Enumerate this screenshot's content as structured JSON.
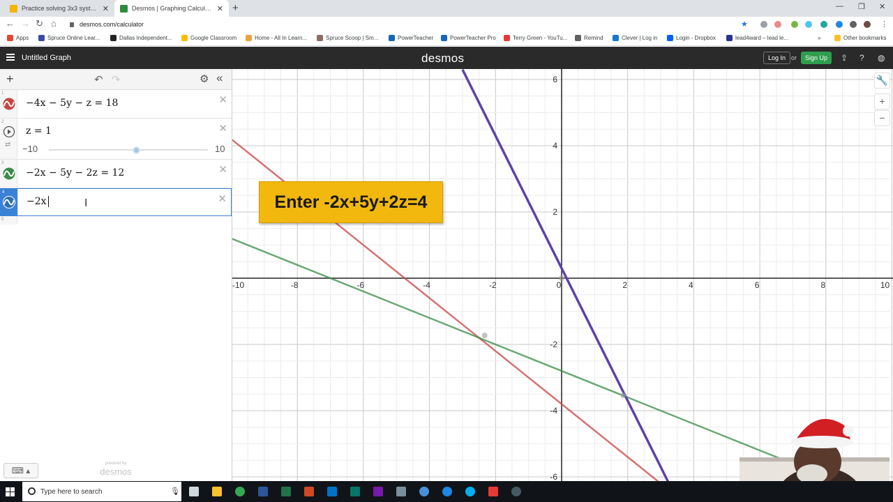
{
  "browser": {
    "tabs": [
      {
        "title": "Practice solving 3x3 systems De",
        "active": false,
        "color": "#f4b400"
      },
      {
        "title": "Desmos | Graphing Calculator",
        "active": true,
        "color": "#2e8b3e"
      }
    ],
    "url": "desmos.com/calculator",
    "bookmarks": [
      "Apps",
      "Spruce Online Lear...",
      "Dallas Independent...",
      "Google Classroom",
      "Home - All In Learn...",
      "Spruce Scoop | Sm...",
      "PowerTeacher",
      "PowerTeacher Pro",
      "Terry Green - YouTu...",
      "Remind",
      "Clever | Log in",
      "Login - Dropbox",
      "lead4ward – lead le..."
    ],
    "other_bookmarks": "Other bookmarks"
  },
  "desmos": {
    "graph_title": "Untitled Graph",
    "logo": "desmos",
    "login": "Log In",
    "or": "or",
    "signup": "Sign Up",
    "powered_by": "powered by",
    "powered_logo": "desmos"
  },
  "expressions": [
    {
      "index": "1",
      "text": "−4x − 5y − z = 18",
      "color": "#c74440"
    },
    {
      "index": "2",
      "text": "z = 1",
      "slider": {
        "min": "−10",
        "max": "10",
        "value": 1
      }
    },
    {
      "index": "3",
      "text": "−2x − 5y − 2z = 12",
      "color": "#388c46"
    },
    {
      "index": "4",
      "text": "−2x",
      "color": "#2d70b3",
      "active": true
    },
    {
      "index": "5",
      "text": ""
    }
  ],
  "callout": "Enter -2x+5y+2z=4",
  "chart_data": {
    "type": "line",
    "xlim": [
      -10,
      10
    ],
    "ylim": [
      -6,
      6
    ],
    "grid": true,
    "x_ticks": [
      "-10",
      "-8",
      "-6",
      "-4",
      "-2",
      "0",
      "2",
      "4",
      "6",
      "8",
      "10"
    ],
    "y_ticks": [
      "6",
      "4",
      "2",
      "-2",
      "-4",
      "-6"
    ],
    "series": [
      {
        "color": "#c74440",
        "x": [
          -10,
          3.5
        ],
        "y": [
          4.2,
          -6.6
        ]
      },
      {
        "color": "#388c46",
        "x": [
          -10,
          10
        ],
        "y": [
          1.2,
          -6.8
        ]
      },
      {
        "color": "#6042a6",
        "x": [
          -3,
          3.3
        ],
        "y": [
          6.3,
          -6.3
        ]
      }
    ],
    "points": [
      {
        "x": 0,
        "y": 0
      },
      {
        "x": -2.33,
        "y": -1.73
      },
      {
        "x": 1.87,
        "y": -3.54
      }
    ]
  },
  "taskbar": {
    "search_placeholder": "Type here to search"
  }
}
